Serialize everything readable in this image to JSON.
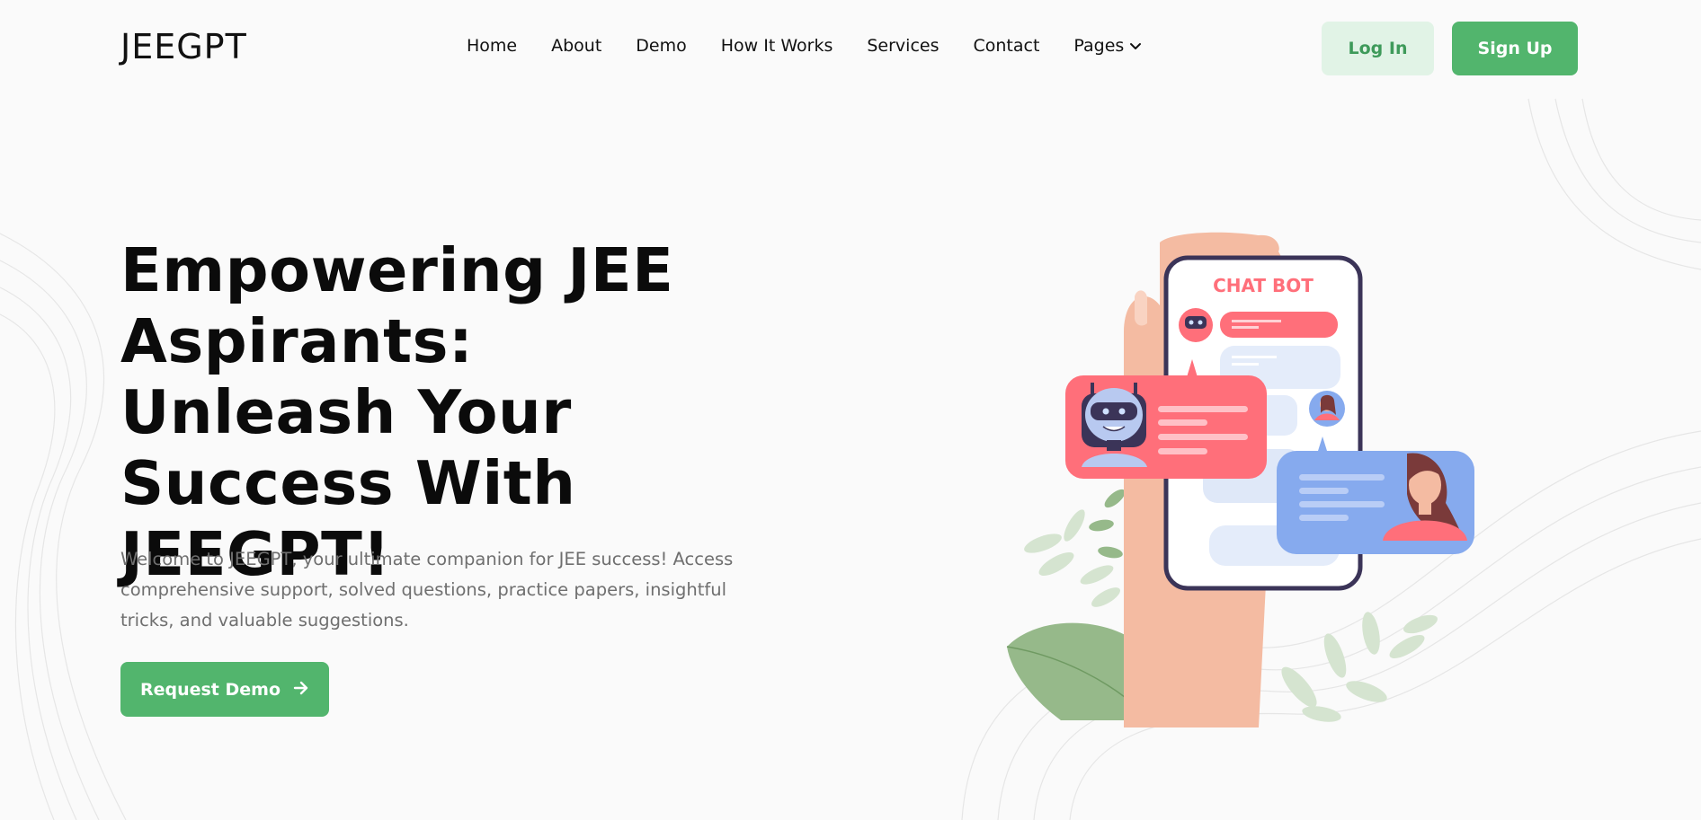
{
  "header": {
    "logo": "JEEGPT",
    "nav": [
      {
        "label": "Home"
      },
      {
        "label": "About"
      },
      {
        "label": "Demo"
      },
      {
        "label": "How It Works"
      },
      {
        "label": "Services"
      },
      {
        "label": "Contact"
      },
      {
        "label": "Pages",
        "icon": "chevron-down-icon"
      }
    ],
    "login_label": "Log In",
    "signup_label": "Sign Up"
  },
  "hero": {
    "title": "Empowering JEE Aspirants: Unleash Your Success With JEEGPT!",
    "description": "Welcome to JEEGPT, your ultimate companion for JEE success! Access comprehensive support, solved questions, practice papers, insightful tricks, and valuable suggestions.",
    "cta_label": "Request Demo",
    "cta_icon": "arrow-right-icon"
  },
  "illustration": {
    "phone_title": "CHAT BOT"
  },
  "colors": {
    "accent": "#52b56d",
    "accent_light": "#e1f3e6",
    "bot_bubble": "#ff6f7a",
    "user_bubble": "#86aaee",
    "phone_frame": "#3b3458"
  }
}
